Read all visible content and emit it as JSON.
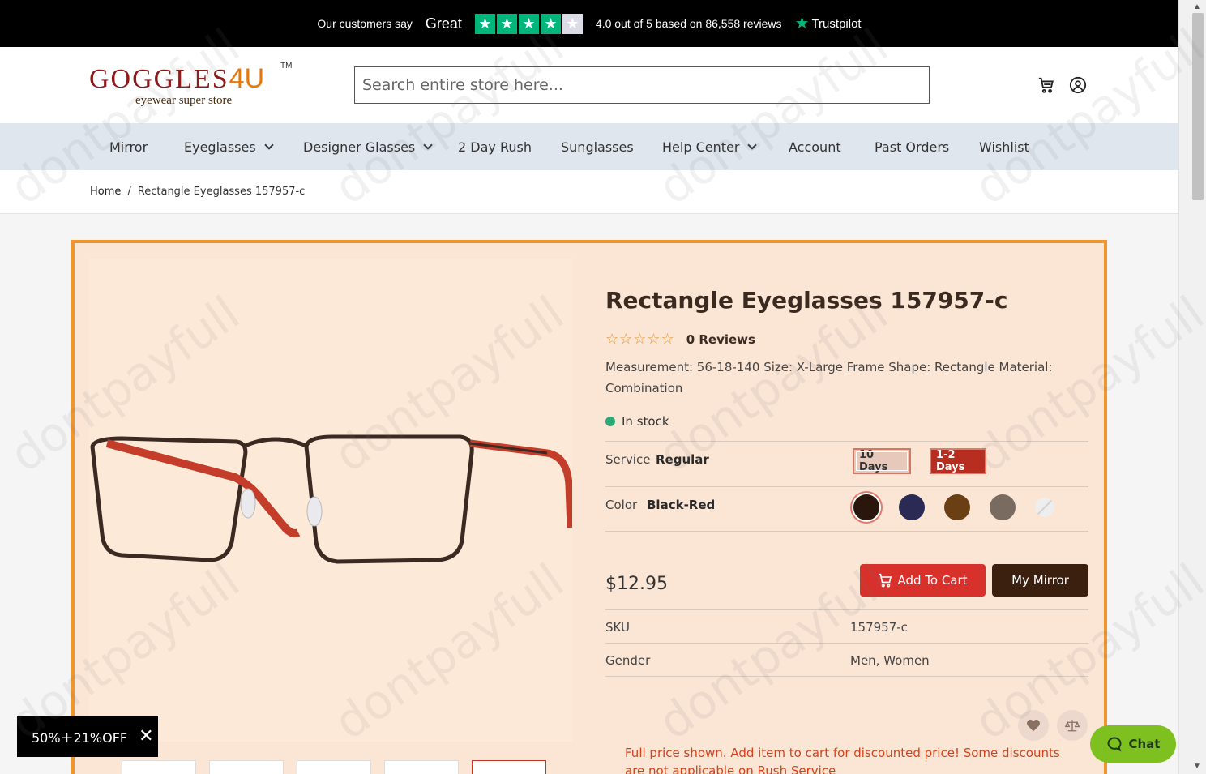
{
  "trustbar": {
    "say": "Our customers say",
    "great": "Great",
    "rating_text": "4.0 out of 5 based on 86,558 reviews",
    "trustpilot": "Trustpilot",
    "stars_filled": 4,
    "stars_total": 5
  },
  "header": {
    "brand": "GOGGLES",
    "brand_suffix": "4U",
    "tm": "TM",
    "tagline": "eyewear super store",
    "search_placeholder": "Search entire store here...",
    "icons": [
      "cart-icon",
      "user-account-icon"
    ]
  },
  "nav": {
    "items": [
      {
        "label": "Mirror",
        "dropdown": false
      },
      {
        "label": "Eyeglasses",
        "dropdown": true
      },
      {
        "label": "Designer Glasses",
        "dropdown": true
      },
      {
        "label": "2 Day Rush",
        "dropdown": false
      },
      {
        "label": "Sunglasses",
        "dropdown": false
      },
      {
        "label": "Help Center",
        "dropdown": true
      },
      {
        "label": "Account",
        "dropdown": false
      },
      {
        "label": "Past Orders",
        "dropdown": false
      },
      {
        "label": "Wishlist",
        "dropdown": false
      }
    ]
  },
  "breadcrumb": {
    "home": "Home",
    "separator": "/",
    "current": "Rectangle Eyeglasses 157957-c"
  },
  "product": {
    "title": "Rectangle Eyeglasses 157957-c",
    "rating_stars": "☆☆☆☆☆",
    "reviews": "0 Reviews",
    "description": "Measurement: 56-18-140 Size: X-Large Frame Shape: Rectangle Material: Combination",
    "stock": "In stock",
    "service_label": "Service",
    "service_value": "Regular",
    "service_options": [
      "10 Days",
      "1-2 Days"
    ],
    "color_label": "Color",
    "color_value": "Black-Red",
    "color_swatches": [
      "#2a160c",
      "#2b2a55",
      "#6b3f14",
      "#7a6b60",
      "#e4dcd6"
    ],
    "price": "$12.95",
    "add_to_cart": "Add To Cart",
    "my_mirror": "My Mirror",
    "sku_label": "SKU",
    "sku_value": "157957-c",
    "gender_label": "Gender",
    "gender_value": "Men, Women",
    "discount_note": "Full price shown. Add item to cart for discounted price! Some discounts are not applicable on Rush Service"
  },
  "promo": {
    "label": "50%＋21%OFF",
    "close": "✕"
  },
  "chat": {
    "label": "Chat"
  },
  "watermark": "dontpayfull",
  "colors": {
    "accent_orange": "#f0962b",
    "cart_red": "#d8302a",
    "mirror_brown": "#3b2010",
    "trust_green": "#00b67a",
    "chat_green": "#7dc020"
  }
}
